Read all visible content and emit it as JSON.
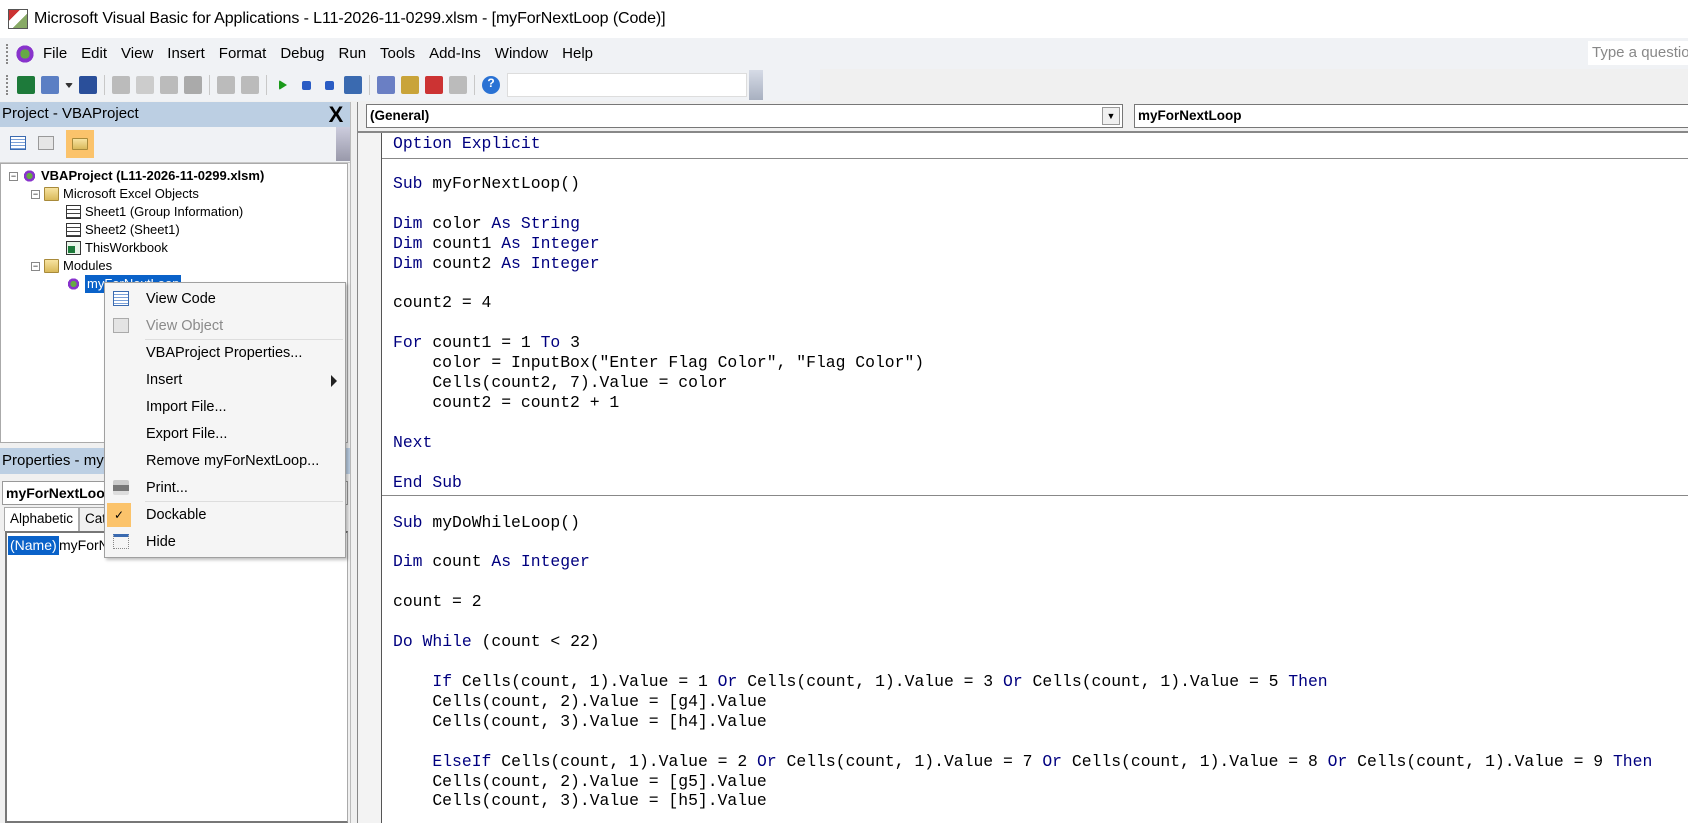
{
  "window": {
    "title": "Microsoft Visual Basic for Applications - L11-2026-11-0299.xlsm - [myForNextLoop (Code)]"
  },
  "menubar": {
    "items": [
      {
        "label": "File",
        "mn": "F"
      },
      {
        "label": "Edit",
        "mn": "E"
      },
      {
        "label": "View",
        "mn": "V"
      },
      {
        "label": "Insert",
        "mn": "I"
      },
      {
        "label": "Format",
        "mn": "o"
      },
      {
        "label": "Debug",
        "mn": "D"
      },
      {
        "label": "Run",
        "mn": "R"
      },
      {
        "label": "Tools",
        "mn": "T"
      },
      {
        "label": "Add-Ins",
        "mn": "A"
      },
      {
        "label": "Window",
        "mn": "W"
      },
      {
        "label": "Help",
        "mn": "H"
      }
    ],
    "help_placeholder": "Type a question for help"
  },
  "toolbar": {
    "icons": [
      "excel-icon",
      "insert-userform-icon",
      "dropdown-icon",
      "save-icon",
      "cut-icon",
      "copy-icon",
      "paste-icon",
      "find-icon",
      "undo-icon",
      "redo-icon",
      "run-icon",
      "break-icon",
      "reset-icon",
      "design-mode-icon",
      "project-explorer-icon",
      "properties-window-icon",
      "object-browser-icon",
      "toolbox-icon",
      "help-icon"
    ]
  },
  "project": {
    "title": "Project - VBAProject",
    "close": "X",
    "tree": [
      {
        "label": "VBAProject (L11-2026-11-0299.xlsm)",
        "level": 0,
        "icon": "vbaproject-icon",
        "bold": true,
        "expander": "-"
      },
      {
        "label": "Microsoft Excel Objects",
        "level": 1,
        "icon": "folder-icon",
        "expander": "-"
      },
      {
        "label": "Sheet1 (Group Information)",
        "level": 2,
        "icon": "sheet-icon"
      },
      {
        "label": "Sheet2 (Sheet1)",
        "level": 2,
        "icon": "sheet-icon"
      },
      {
        "label": "ThisWorkbook",
        "level": 2,
        "icon": "workbook-icon"
      },
      {
        "label": "Modules",
        "level": 1,
        "icon": "folder-icon",
        "expander": "-"
      },
      {
        "label": "myForNextLoop",
        "level": 2,
        "icon": "module-icon",
        "selected": true
      }
    ]
  },
  "properties": {
    "title": "Properties - myForNextLoop",
    "object": "myForNextLoop",
    "tabs": [
      "Alphabetic",
      "Categorized"
    ],
    "rows": [
      {
        "name": "(Name)",
        "value": "myForNextLoop"
      }
    ]
  },
  "editor": {
    "object_combo": "(General)",
    "procedure_combo": "myForNextLoop",
    "keywords": [
      "Option",
      "Explicit",
      "Sub",
      "Dim",
      "As",
      "String",
      "Integer",
      "For",
      "To",
      "Next",
      "End",
      "Do",
      "While",
      "If",
      "Or",
      "Then",
      "ElseIf"
    ],
    "keyword_color": "#00007f",
    "lines": [
      "Option Explicit",
      "",
      "Sub myForNextLoop()",
      "",
      "Dim color As String",
      "Dim count1 As Integer",
      "Dim count2 As Integer",
      "",
      "count2 = 4",
      "",
      "For count1 = 1 To 3",
      "    color = InputBox(\"Enter Flag Color\", \"Flag Color\")",
      "    Cells(count2, 7).Value = color",
      "    count2 = count2 + 1",
      "",
      "Next",
      "",
      "End Sub",
      "",
      "Sub myDoWhileLoop()",
      "",
      "Dim count As Integer",
      "",
      "count = 2",
      "",
      "Do While (count < 22)",
      "",
      "    If Cells(count, 1).Value = 1 Or Cells(count, 1).Value = 3 Or Cells(count, 1).Value = 5 Then",
      "    Cells(count, 2).Value = [g4].Value",
      "    Cells(count, 3).Value = [h4].Value",
      "",
      "    ElseIf Cells(count, 1).Value = 2 Or Cells(count, 1).Value = 7 Or Cells(count, 1).Value = 8 Or Cells(count, 1).Value = 9 Then",
      "    Cells(count, 2).Value = [g5].Value",
      "    Cells(count, 3).Value = [h5].Value"
    ]
  },
  "context_menu": {
    "items": [
      {
        "label": "View Code",
        "mn": "o",
        "icon": "view-code-icon"
      },
      {
        "label": "View Object",
        "mn": "b",
        "icon": "view-object-icon",
        "disabled": true
      },
      {
        "sep": true
      },
      {
        "label": "VBAProject Properties...",
        "mn": "e"
      },
      {
        "label": "Insert",
        "mn": "n",
        "submenu": true
      },
      {
        "label": "Import File...",
        "mn": "I"
      },
      {
        "label": "Export File...",
        "mn": "E"
      },
      {
        "label": "Remove myForNextLoop...",
        "mn": "R"
      },
      {
        "label": "Print...",
        "mn": "P",
        "icon": "print-icon"
      },
      {
        "sep": true
      },
      {
        "label": "Dockable",
        "mn": "k",
        "icon": "check-icon",
        "checked": true
      },
      {
        "label": "Hide",
        "mn": "H",
        "icon": "hide-icon"
      }
    ]
  }
}
